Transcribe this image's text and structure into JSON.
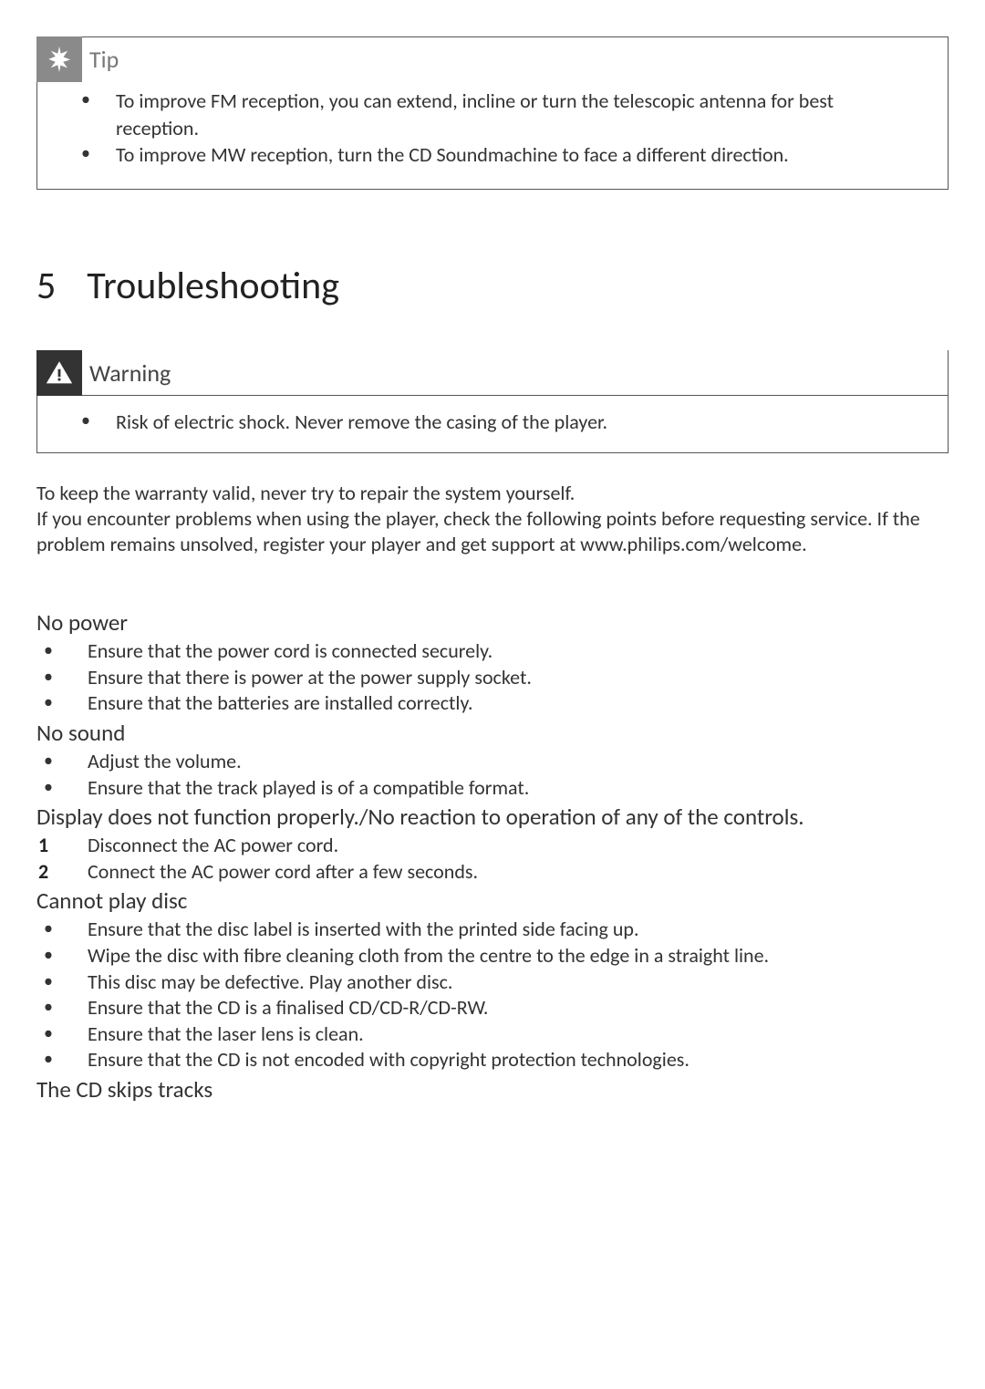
{
  "tip": {
    "label": "Tip",
    "items": [
      "To improve FM reception, you can extend, incline or turn the telescopic antenna for best reception.",
      "To improve MW reception, turn the CD Soundmachine to face a different direction."
    ]
  },
  "section": {
    "number": "5",
    "title": "Troubleshooting"
  },
  "warning": {
    "label": "Warning",
    "items": [
      "Risk of electric shock. Never remove the casing of the player."
    ]
  },
  "intro_para": "To keep the warranty valid, never try to repair the system yourself.\nIf you encounter problems when using the player, check the following points before requesting service. If the problem remains unsolved, register your player and get support at www.philips.com/welcome.",
  "troubleshooting": [
    {
      "heading": "No power",
      "type": "bullets",
      "items": [
        "Ensure that the power cord is connected securely.",
        "Ensure that there is power at the power supply socket.",
        "Ensure that the batteries are installed correctly."
      ]
    },
    {
      "heading": "No sound",
      "type": "bullets",
      "items": [
        "Adjust the volume.",
        "Ensure that the track played is of a compatible format."
      ]
    },
    {
      "heading": "Display does not function properly./No reaction to operation of any of the controls.",
      "type": "numbers",
      "items": [
        "Disconnect the AC power cord.",
        "Connect the AC power cord after a few seconds."
      ]
    },
    {
      "heading": "Cannot play disc",
      "type": "bullets",
      "items": [
        "Ensure that the disc label is inserted with the printed side facing up.",
        "Wipe the disc with fibre cleaning cloth from the centre to the edge in a straight line.",
        "This disc may be defective. Play another disc.",
        "Ensure that the CD is a finalised CD/CD-R/CD-RW.",
        "Ensure that the laser lens is clean.",
        "Ensure that the CD is not encoded with copyright protection technologies."
      ]
    },
    {
      "heading": "The CD skips tracks",
      "type": "bullets",
      "items": []
    }
  ]
}
